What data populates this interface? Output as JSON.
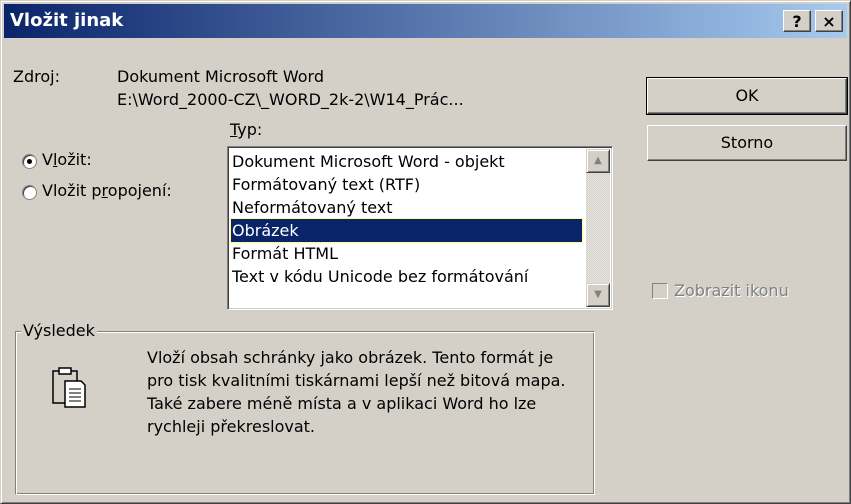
{
  "window": {
    "title": "Vložit jinak",
    "help_label": "?",
    "close_label": "×"
  },
  "source": {
    "label": "Zdroj:",
    "line1": "Dokument Microsoft Word",
    "line2": "E:\\Word_2000-CZ\\_WORD_2k-2\\W14_Prác..."
  },
  "type_label": {
    "underlined": "T",
    "rest": "yp:"
  },
  "options": {
    "paste": {
      "before": "V",
      "underlined": "l",
      "after": "ožit:",
      "checked": true
    },
    "paste_link": {
      "before": "Vložit p",
      "underlined": "r",
      "after": "opojení:",
      "checked": false
    }
  },
  "list": {
    "items": [
      "Dokument Microsoft Word - objekt",
      "Formátovaný text (RTF)",
      "Neformátovaný text",
      "Obrázek",
      "Formát HTML",
      "Text v kódu Unicode bez formátování"
    ],
    "selected_index": 3
  },
  "buttons": {
    "ok": "OK",
    "cancel": "Storno"
  },
  "show_icon": {
    "label": "Zobrazit ikonu",
    "checked": false,
    "enabled": false
  },
  "result": {
    "label": "Výsledek",
    "lines": [
      "Vloží obsah schránky jako obrázek. Tento formát je",
      "pro tisk kvalitními tiskárnami lepší než bitová mapa.",
      "Také zabere méně místa a v aplikaci Word ho lze",
      "rychleji překreslovat."
    ]
  },
  "colors": {
    "title_start": "#0a246a",
    "title_end": "#a6caf0",
    "face": "#d4d0c8",
    "selection": "#0a246a"
  }
}
